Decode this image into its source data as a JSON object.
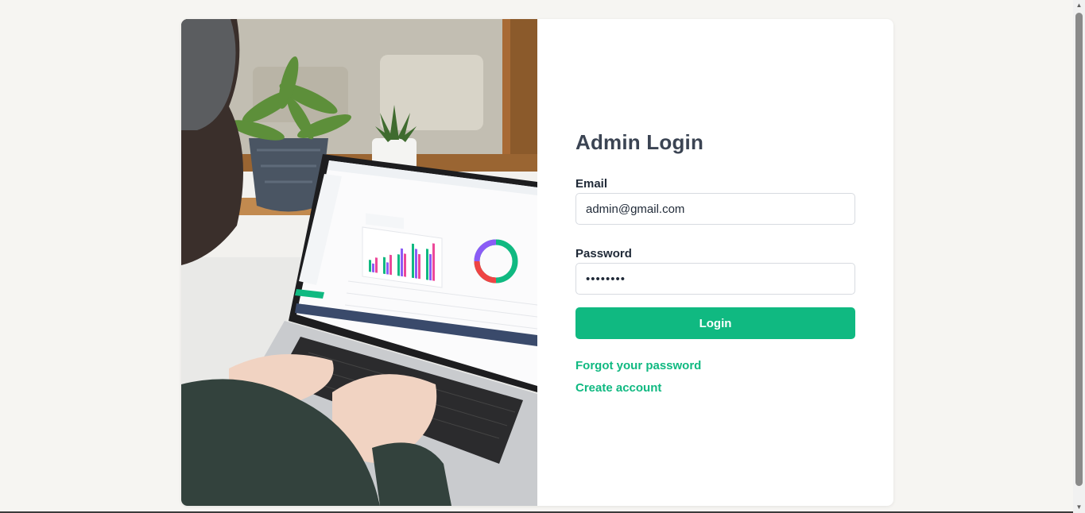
{
  "login": {
    "title": "Admin Login",
    "email_label": "Email",
    "email_value": "admin@gmail.com",
    "password_label": "Password",
    "password_value": "password",
    "login_button": "Login",
    "forgot_link": "Forgot your password",
    "create_link": "Create account"
  },
  "colors": {
    "accent": "#10b981",
    "background": "#f6f5f2",
    "title": "#3b4453"
  },
  "icons": {
    "scroll_up": "triangle-up",
    "scroll_down": "triangle-down"
  }
}
